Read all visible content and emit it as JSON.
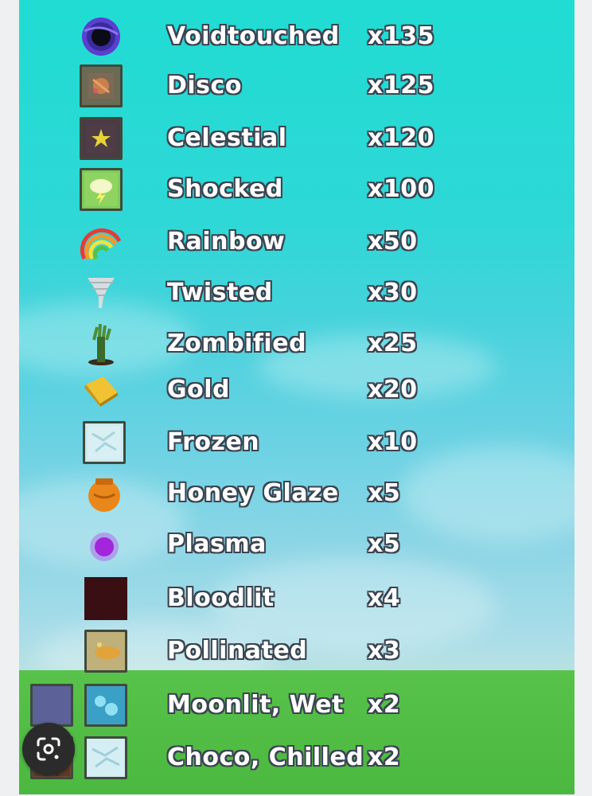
{
  "rows": [
    {
      "name": "Voidtouched",
      "multiplier": "x135",
      "icon": "black-hole-icon"
    },
    {
      "name": "Disco",
      "multiplier": "x125",
      "icon": "disco-icon"
    },
    {
      "name": "Celestial",
      "multiplier": "x120",
      "icon": "star-icon"
    },
    {
      "name": "Shocked",
      "multiplier": "x100",
      "icon": "lightning-cloud-icon"
    },
    {
      "name": "Rainbow",
      "multiplier": "x50",
      "icon": "rainbow-icon"
    },
    {
      "name": "Twisted",
      "multiplier": "x30",
      "icon": "tornado-icon"
    },
    {
      "name": "Zombified",
      "multiplier": "x25",
      "icon": "zombie-hand-icon"
    },
    {
      "name": "Gold",
      "multiplier": "x20",
      "icon": "gold-bar-icon"
    },
    {
      "name": "Frozen",
      "multiplier": "x10",
      "icon": "ice-icon"
    },
    {
      "name": "Honey Glaze",
      "multiplier": "x5",
      "icon": "honey-pot-icon"
    },
    {
      "name": "Plasma",
      "multiplier": "x5",
      "icon": "plasma-icon"
    },
    {
      "name": "Bloodlit",
      "multiplier": "x4",
      "icon": "blood-moon-icon"
    },
    {
      "name": "Pollinated",
      "multiplier": "x3",
      "icon": "pollen-icon"
    },
    {
      "name": "Moonlit, Wet",
      "multiplier": "x2",
      "icon": "moon-and-water-icon"
    },
    {
      "name": "Choco, Chilled",
      "multiplier": "x2",
      "icon": "chocolate-and-ice-icon"
    }
  ],
  "colors": {
    "sky_top": "#20dcd3",
    "sky_bottom": "#b6e1e3",
    "grass": "#4bb83f",
    "text": "#ffffff",
    "text_outline": "#3b4451"
  },
  "overlay": {
    "lens_button": "google-lens-icon"
  }
}
